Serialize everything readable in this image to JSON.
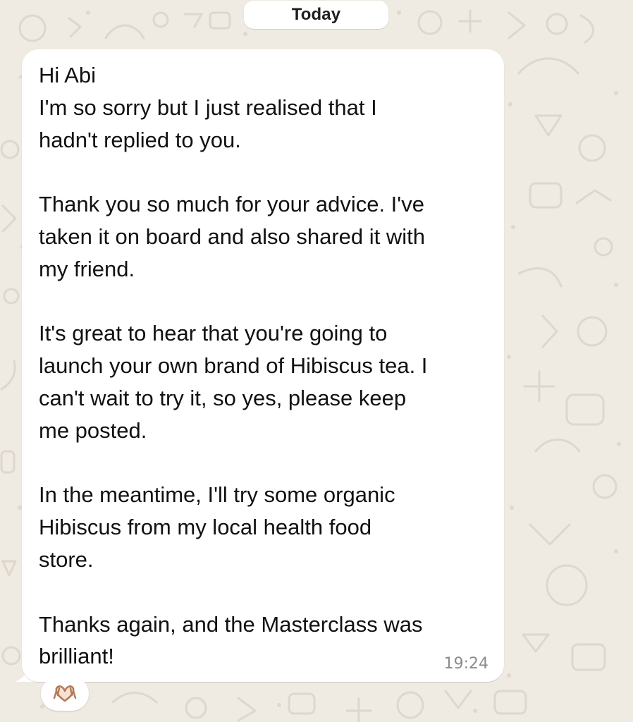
{
  "chat": {
    "date_label": "Today",
    "message": {
      "text": "Hi Abi\nI'm so sorry but I just realised that I\nhadn't replied to you.\n\nThank you so much for your advice. I've\ntaken it on board and also shared it with\nmy friend.\n\nIt's great to hear that you're going to\nlaunch your own brand of Hibiscus tea. I\ncan't wait to try it, so yes, please keep\nme posted.\n\nIn the meantime, I'll try some organic\nHibiscus from my local health food\nstore.\n\nThanks again, and the Masterclass was\nbrilliant!",
      "time": "19:24"
    },
    "reaction": {
      "icon": "heart-hands-icon"
    }
  },
  "colors": {
    "background": "#efeae2",
    "bubble": "#ffffff",
    "text": "#111111",
    "time": "#8b8b8b",
    "reaction_skin": "#b57a57"
  }
}
